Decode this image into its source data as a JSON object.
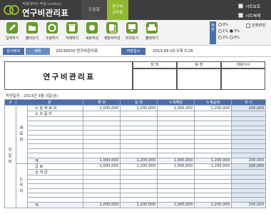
{
  "app": {
    "subtitle": "엑셀데이터 엑셀 coolboy",
    "title": "연구비관리표",
    "nav_usage": "도움말",
    "nav_current_line1": "연구비",
    "nav_current_line2": "관리표",
    "sheet_protect": "시트보호",
    "sheet_unprotect": "시트해제"
  },
  "toolbar": {
    "items": [
      {
        "label": "입력하기",
        "icon": "pencil-icon",
        "color": "#6a9a2c"
      },
      {
        "label": "불러오기",
        "icon": "folder-open-icon",
        "color": "#6a9a2c"
      },
      {
        "label": "수정하기",
        "icon": "refresh-icon",
        "color": "#6a9a2c"
      },
      {
        "label": "삭제하기",
        "icon": "trash-icon",
        "color": "#6a9a2c"
      },
      {
        "label": "새로작성",
        "icon": "new-doc-icon",
        "color": "#6a9a2c"
      },
      {
        "label": "재분서작성",
        "icon": "copy-icon",
        "color": "#6a9a2c"
      },
      {
        "label": "미리보기",
        "icon": "monitor-icon",
        "color": "#6a9a2c"
      },
      {
        "label": "출력하기",
        "icon": "printer-icon",
        "color": "#6a9a2c"
      }
    ],
    "zoom_label": "화면",
    "zoom_options": [
      "0%",
      "1%",
      "2%",
      "3%",
      "4%"
    ],
    "zoom_selected": "3%",
    "fullscreen_label": "전체화면"
  },
  "doc_info": {
    "doc_label": "문서정보",
    "title_label": "제목",
    "doc_value": "20130503 연구비관리표",
    "saved_label": "저장일시",
    "saved_value": "2013-05-03  오후 5:26"
  },
  "document": {
    "title": "연구비관리표",
    "approval": {
      "col1": "담 당",
      "col2": "팀 장",
      "col3": "대표이사"
    },
    "write_date": "작성일자 : 2013년 5월 3일(금)",
    "headers": [
      "구",
      "분",
      "예  정",
      "실  제",
      "누계예정",
      "누계실제",
      "차  이"
    ],
    "section1_label": "재료비",
    "section2_label": "직접비",
    "sub2_label": "노무비",
    "rows": [
      {
        "c1": "시 험 재 료 비",
        "c2": "1,000,000",
        "c3": "1,200,000",
        "c4": "1,000,000",
        "c5": "1,200,000",
        "c6": "200,000"
      },
      {
        "c1": "소 모 품 비",
        "c2": "",
        "c3": "",
        "c4": "",
        "c5": "",
        "c6": ""
      },
      {
        "c1": "",
        "c2": "",
        "c3": "",
        "c4": "",
        "c5": "",
        "c6": ""
      },
      {
        "c1": "",
        "c2": "",
        "c3": "",
        "c4": "",
        "c5": "",
        "c6": ""
      },
      {
        "c1": "",
        "c2": "",
        "c3": "",
        "c4": "",
        "c5": "",
        "c6": ""
      },
      {
        "c1": "",
        "c2": "",
        "c3": "",
        "c4": "",
        "c5": "",
        "c6": ""
      },
      {
        "c1": "",
        "c2": "",
        "c3": "",
        "c4": "",
        "c5": "",
        "c6": ""
      },
      {
        "c1": "",
        "c2": "",
        "c3": "",
        "c4": "",
        "c5": "",
        "c6": ""
      },
      {
        "c1": "",
        "c2": "",
        "c3": "",
        "c4": "",
        "c5": "",
        "c6": ""
      },
      {
        "c1": "",
        "c2": "",
        "c3": "",
        "c4": "",
        "c5": "",
        "c6": ""
      },
      {
        "c1": "",
        "c2": "",
        "c3": "",
        "c4": "",
        "c5": "",
        "c6": ""
      }
    ],
    "sum1": {
      "label": "계",
      "c2": "1,000,000",
      "c3": "1,200,000",
      "c4": "1,000,000",
      "c5": "1,200,000",
      "c6": "200,000"
    },
    "rows2": [
      {
        "c1": "급 료",
        "c2": "1,000,000",
        "c3": "1,200,000",
        "c4": "1,000,000",
        "c5": "1,200,000",
        "c6": "200,000"
      },
      {
        "c1": "상 여 금",
        "c2": "",
        "c3": "",
        "c4": "",
        "c5": "",
        "c6": ""
      },
      {
        "c1": "",
        "c2": "",
        "c3": "",
        "c4": "",
        "c5": "",
        "c6": ""
      },
      {
        "c1": "",
        "c2": "",
        "c3": "",
        "c4": "",
        "c5": "",
        "c6": ""
      },
      {
        "c1": "",
        "c2": "",
        "c3": "",
        "c4": "",
        "c5": "",
        "c6": ""
      },
      {
        "c1": "",
        "c2": "",
        "c3": "",
        "c4": "",
        "c5": "",
        "c6": ""
      },
      {
        "c1": "",
        "c2": "",
        "c3": "",
        "c4": "",
        "c5": "",
        "c6": ""
      },
      {
        "c1": "",
        "c2": "",
        "c3": "",
        "c4": "",
        "c5": "",
        "c6": ""
      }
    ],
    "sum2": {
      "label": "계",
      "c2": "1,000,000",
      "c3": "1,200,000",
      "c4": "1,000,000",
      "c5": "1,200,000",
      "c6": "200,000"
    }
  }
}
